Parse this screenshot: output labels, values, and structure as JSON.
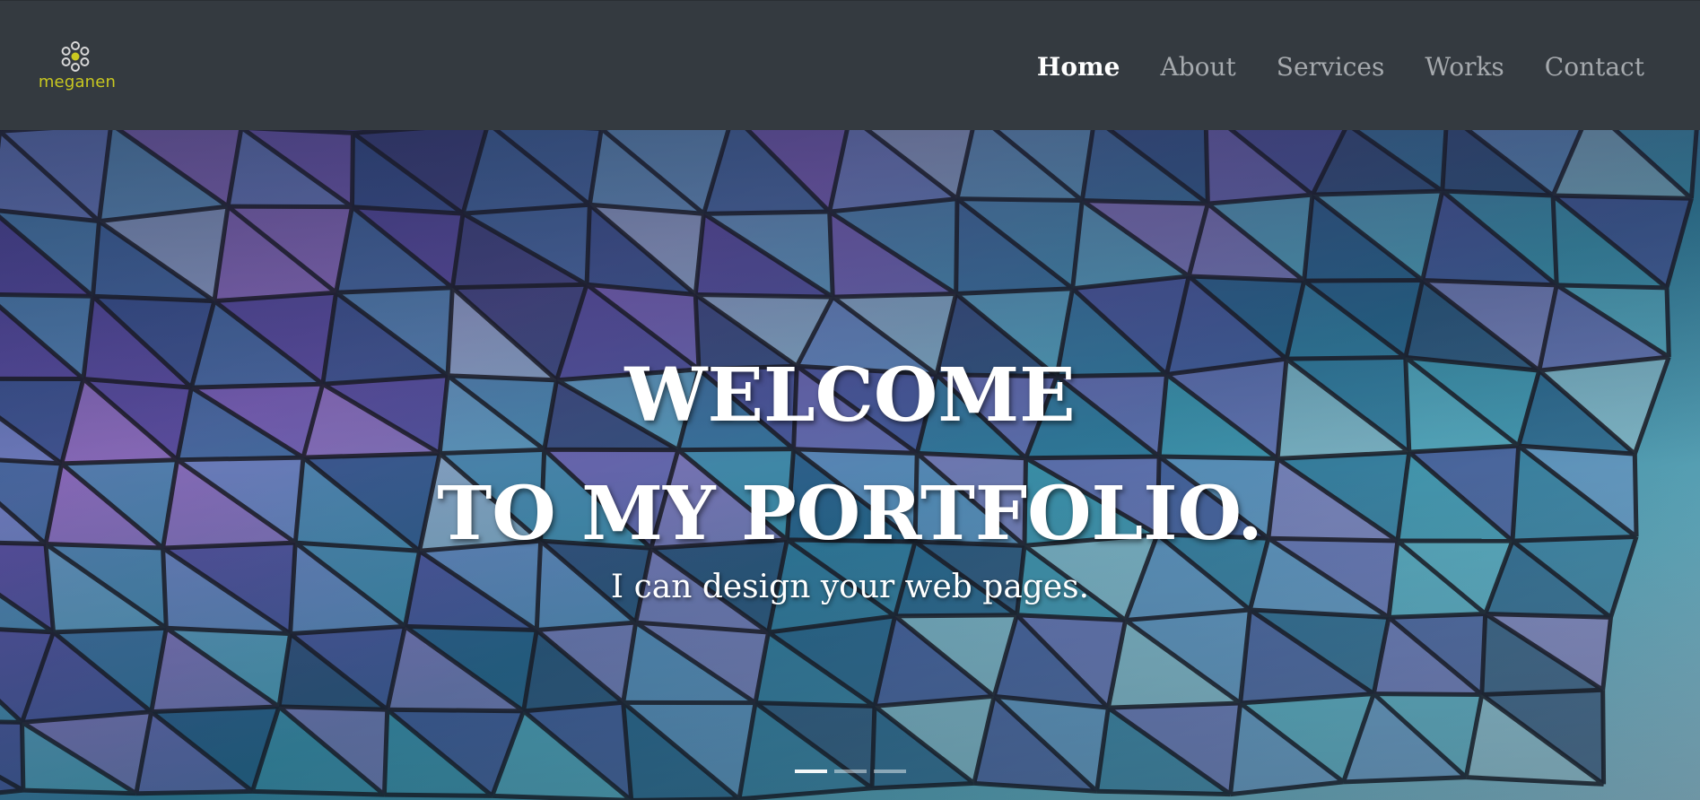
{
  "brand": {
    "name": "meganen",
    "icon": "flower-logo-icon",
    "color": "#c9c820"
  },
  "nav": {
    "items": [
      {
        "label": "Home",
        "active": true
      },
      {
        "label": "About",
        "active": false
      },
      {
        "label": "Services",
        "active": false
      },
      {
        "label": "Works",
        "active": false
      },
      {
        "label": "Contact",
        "active": false
      }
    ]
  },
  "hero": {
    "title_line1": "WELCOME",
    "title_line2": "TO MY PORTFOLIO.",
    "subtitle": "I can design your web pages.",
    "slide_count": 3,
    "active_slide": 1
  },
  "colors": {
    "navbar": "#343a40",
    "nav_inactive": "#a5a9ad",
    "nav_active": "#ffffff"
  }
}
